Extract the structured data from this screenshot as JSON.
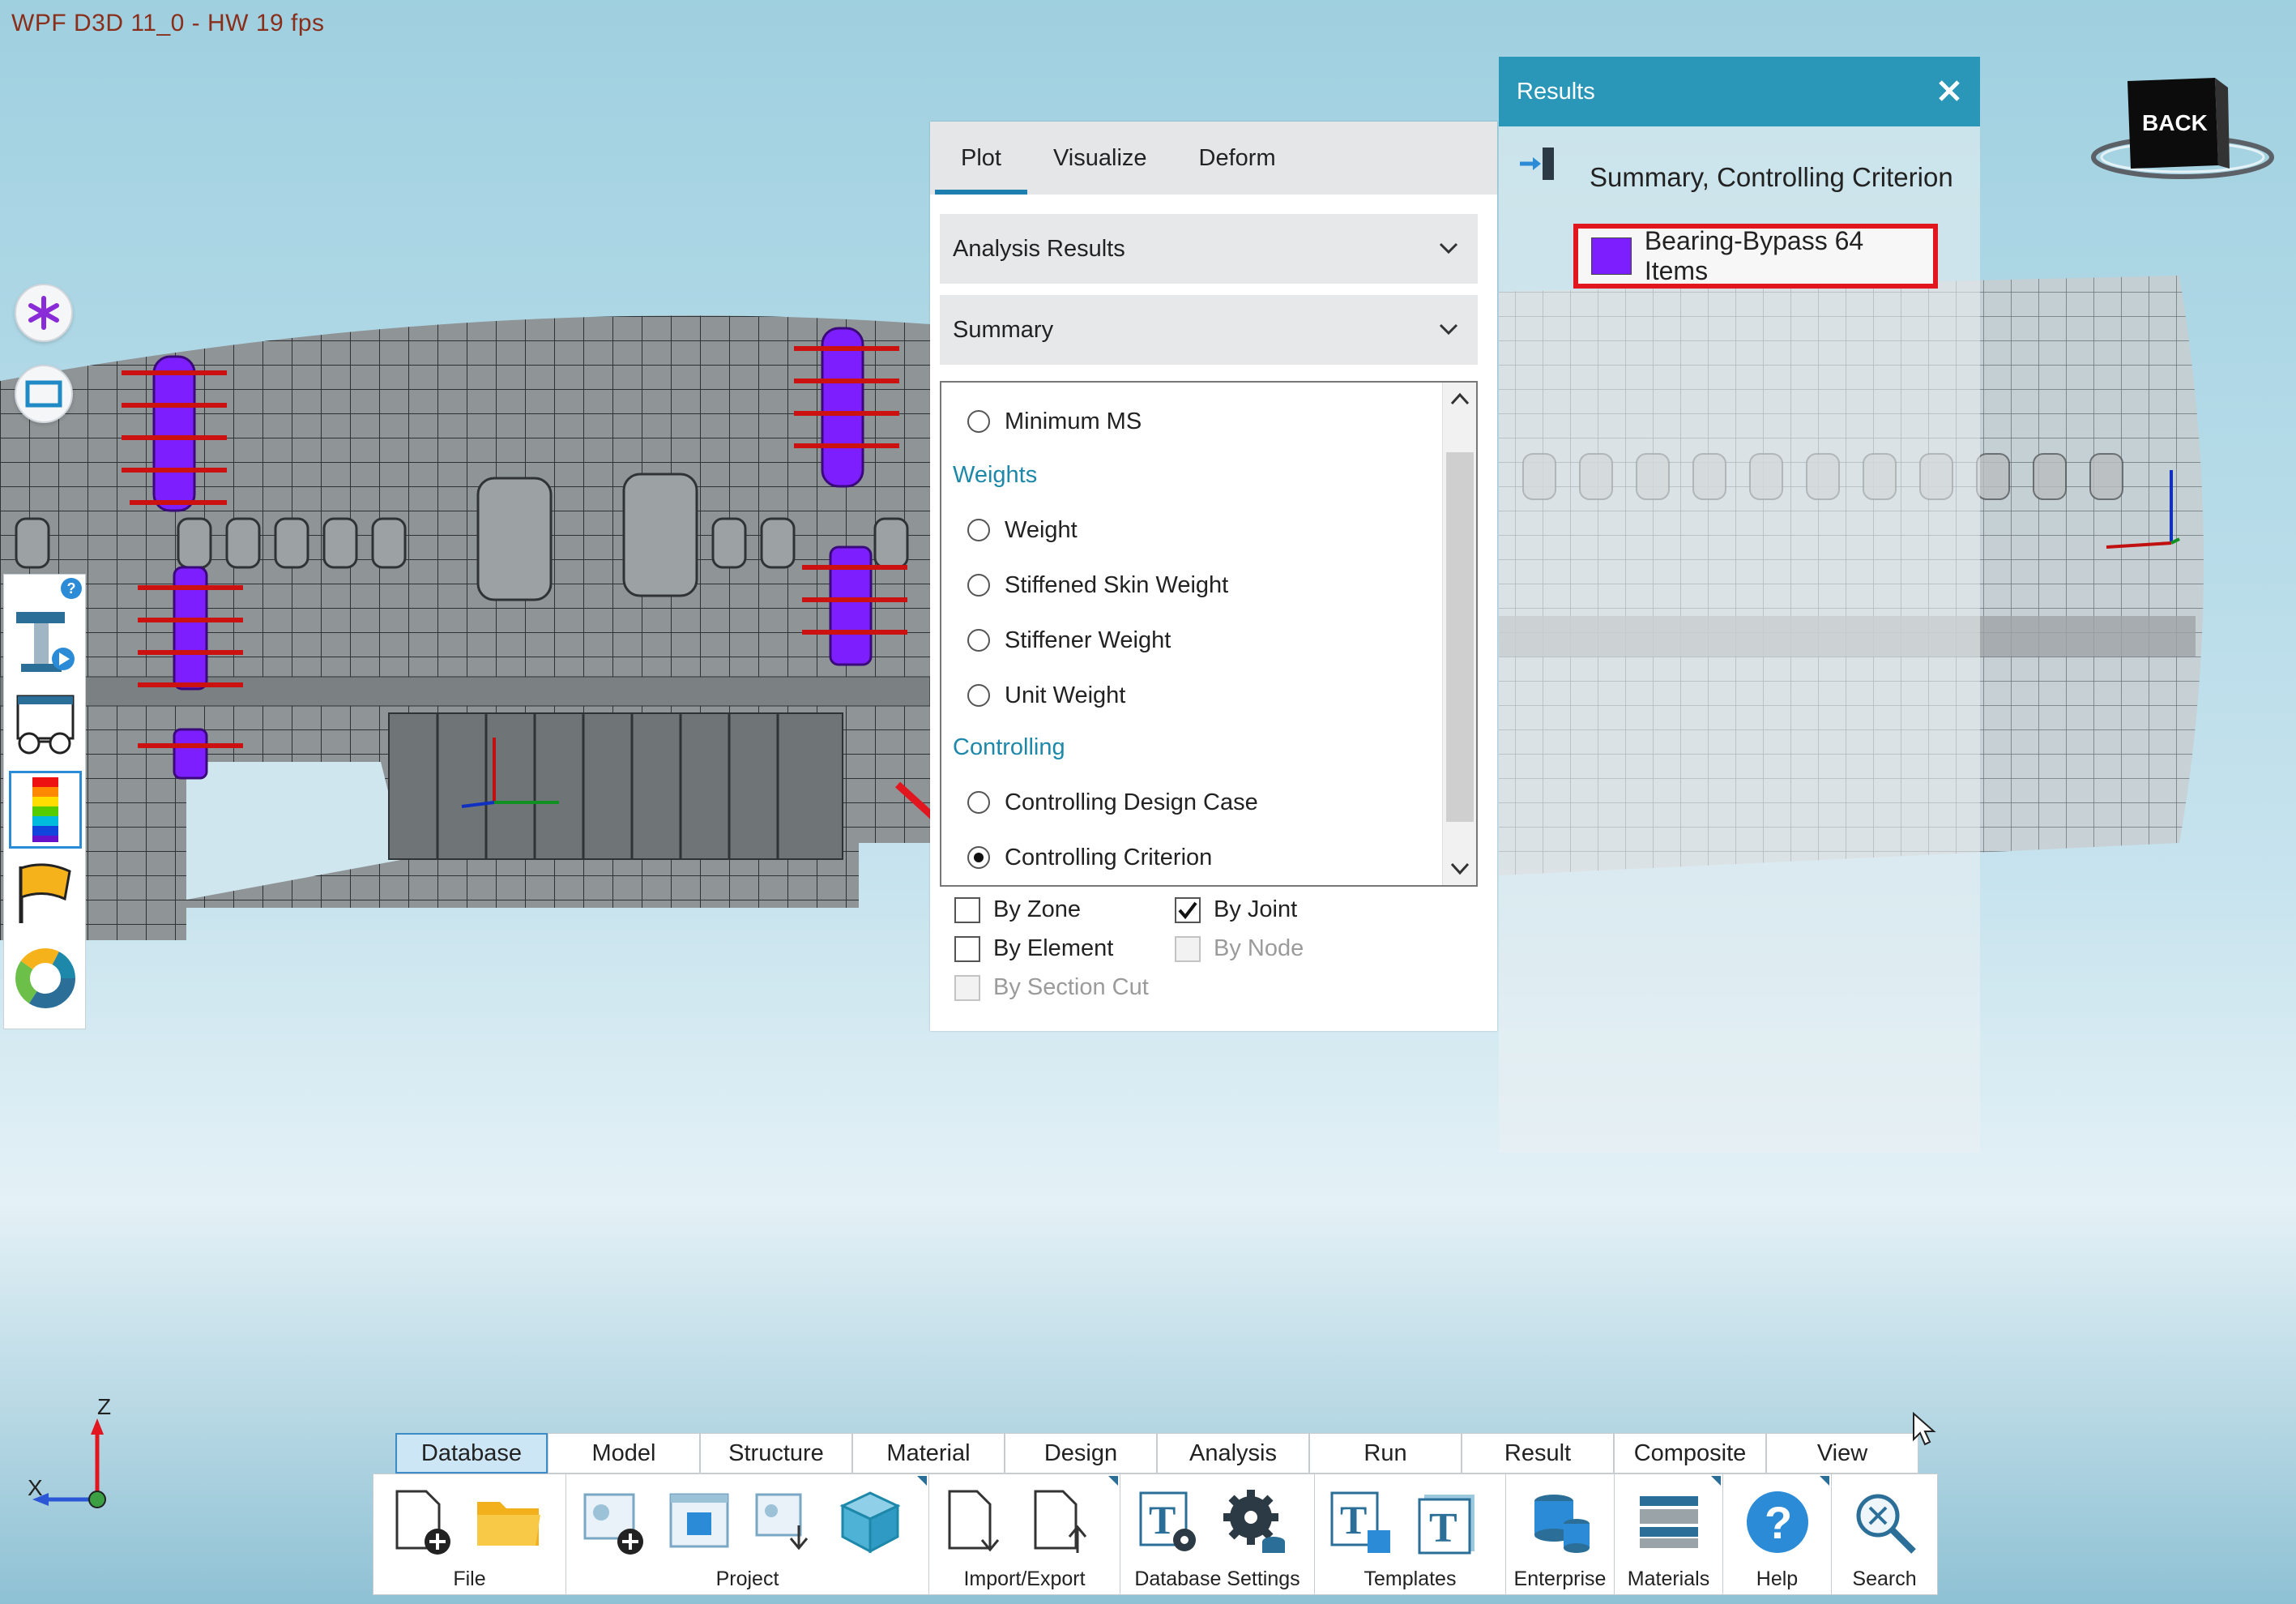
{
  "window": {
    "title": "WPF D3D 11_0 - HW  19  fps"
  },
  "left_toolbar": {
    "circle_buttons": [
      {
        "name": "asterisk-button",
        "icon": "asterisk-icon"
      },
      {
        "name": "view-frame-button",
        "icon": "rectangle-icon"
      }
    ],
    "tools": [
      {
        "name": "help-badge",
        "icon": "question-icon",
        "label": "?"
      },
      {
        "name": "hypersizer-tool",
        "icon": "t-beam-play-icon"
      },
      {
        "name": "glasses-view-tool",
        "icon": "glasses-icon"
      },
      {
        "name": "contour-tool",
        "icon": "color-scale-icon",
        "selected": true
      },
      {
        "name": "flag-tool",
        "icon": "flag-icon"
      },
      {
        "name": "donut-chart-tool",
        "icon": "donut-chart-icon"
      }
    ]
  },
  "plot_panel": {
    "tabs": [
      {
        "label": "Plot",
        "active": true
      },
      {
        "label": "Visualize",
        "active": false
      },
      {
        "label": "Deform",
        "active": false
      }
    ],
    "dropdown_1": {
      "value": "Analysis Results"
    },
    "dropdown_2": {
      "value": "Summary"
    },
    "list": {
      "item_minimum_ms": "Minimum MS",
      "section_weights": "Weights",
      "item_weight": "Weight",
      "item_stiffened_skin_weight": "Stiffened Skin Weight",
      "item_stiffener_weight": "Stiffener Weight",
      "item_unit_weight": "Unit Weight",
      "section_controlling": "Controlling",
      "item_controlling_design_case": "Controlling Design Case",
      "item_controlling_criterion": "Controlling Criterion",
      "selected": "Controlling Criterion"
    },
    "checks": {
      "by_zone": {
        "label": "By Zone",
        "checked": false,
        "enabled": true
      },
      "by_joint": {
        "label": "By Joint",
        "checked": true,
        "enabled": true
      },
      "by_element": {
        "label": "By Element",
        "checked": false,
        "enabled": true
      },
      "by_node": {
        "label": "By Node",
        "checked": false,
        "enabled": false
      },
      "by_section_cut": {
        "label": "By Section Cut",
        "checked": false,
        "enabled": false
      }
    }
  },
  "results_panel": {
    "title": "Results",
    "summary": "Summary, Controlling Criterion",
    "legend": {
      "label": "Bearing-Bypass 64 Items",
      "color": "#7d1eff"
    }
  },
  "back_cube": {
    "label": "BACK"
  },
  "ribbon": {
    "tabs": [
      {
        "label": "Database",
        "active": true
      },
      {
        "label": "Model",
        "active": false
      },
      {
        "label": "Structure",
        "active": false
      },
      {
        "label": "Material",
        "active": false
      },
      {
        "label": "Design",
        "active": false
      },
      {
        "label": "Analysis",
        "active": false
      },
      {
        "label": "Run",
        "active": false
      },
      {
        "label": "Result",
        "active": false
      },
      {
        "label": "Composite",
        "active": false
      },
      {
        "label": "View",
        "active": false
      }
    ],
    "groups": {
      "file": "File",
      "project": "Project",
      "import_export": "Import/Export",
      "database_settings": "Database Settings",
      "templates": "Templates",
      "enterprise": "Enterprise",
      "materials": "Materials",
      "help": "Help",
      "search": "Search"
    }
  },
  "axis": {
    "z": "Z",
    "x": "X"
  },
  "colors": {
    "accent": "#2a97b8",
    "highlight_red": "#e2161f",
    "joint_purple": "#7d1eff",
    "section_teal": "#1d88aa"
  }
}
